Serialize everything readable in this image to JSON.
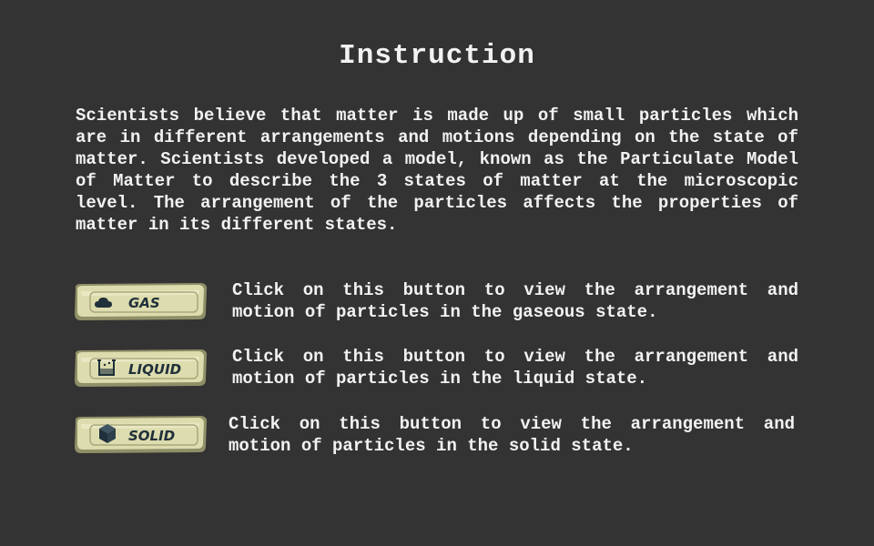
{
  "title": "Instruction",
  "intro": "Scientists believe that matter is made up of small particles which are in different arrangements and motions depending on the state of matter. Scientists developed a model, known as the Particulate Model of Matter to describe the 3 states of matter at the microscopic level. The arrangement of the particles affects the properties of matter in its different states.",
  "buttons": [
    {
      "label": "GAS",
      "icon": "cloud-icon",
      "description": "Click on this button to view the arrangement and motion of particles in the gaseous state."
    },
    {
      "label": "LIQUID",
      "icon": "beaker-icon",
      "description": "Click on this button to view the arrangement and motion of particles in the liquid state."
    },
    {
      "label": "SOLID",
      "icon": "cube-icon",
      "description": "Click on this button to view the arrangement and motion of particles in the solid state."
    }
  ],
  "colors": {
    "background": "#333333",
    "text": "#f2f2f2",
    "button_face": "#dcdcae",
    "button_border": "#8f8f68",
    "button_label": "#20303a"
  }
}
